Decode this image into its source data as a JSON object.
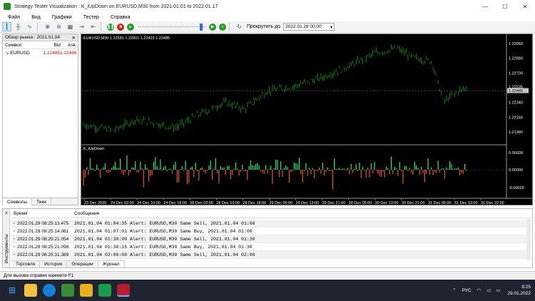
{
  "window": {
    "title": "Strategy Tester Visualization : K_iUpDown on EURUSD,M30 from 2021.01.01 to 2022.01.17",
    "controls": [
      "—",
      "☐",
      "✕"
    ]
  },
  "menu": [
    "Файл",
    "Вид",
    "Графики",
    "Тестер",
    "Справка"
  ],
  "toolbar": {
    "scroll_label": "Прокрутить до",
    "scroll_date": "2022.01.28 00:00",
    "slider_position": 0.95
  },
  "market_watch": {
    "title": "Обзор рынка : 2021.01.04",
    "close": "✕",
    "columns": [
      "Символ",
      "Bid",
      "Ask"
    ],
    "rows": [
      {
        "symbol": "EURUSD",
        "bid": "1.22485",
        "ask": "1.22486"
      }
    ],
    "tabs": [
      "Символы",
      "Тики"
    ]
  },
  "chart": {
    "header": "EURUSD,M30  1.22581 1.22601 1.22429 1.22485",
    "indicator_label": "K_iUpDown",
    "price_ticks": [
      "1.23060",
      "1.22880",
      "1.22700",
      "1.22535",
      "1.22485",
      "1.22340",
      "1.22160",
      "1.21980"
    ],
    "current_price": "1.22485",
    "indicator_ticks": [
      "0.00028",
      "0.00000",
      "-0.00029"
    ],
    "time_ticks": [
      "23 Dec 2020",
      "24 Dec 02:00",
      "24 Dec 10:00",
      "24 Dec 18:00",
      "28 Dec 02:00",
      "28 Dec 10:00",
      "28 Dec 18:00",
      "29 Dec 05:00",
      "29 Dec 13:00",
      "29 Dec 21:00",
      "30 Dec 05:00",
      "30 Dec 13:00",
      "30 Dec 21:00",
      "31 Dec 05:00",
      "31 Dec 13:00",
      "31 Dec 22:00"
    ],
    "colors": {
      "bg": "#000000",
      "candles": "#16a016",
      "up": "#2ee87a",
      "down": "#e8562b",
      "grid": "#555555"
    }
  },
  "toolbox": {
    "side_label": "Инструменты",
    "close": "✕",
    "columns": [
      "Время",
      "Сообщение"
    ],
    "rows": [
      {
        "time": "2022.01.29 08:25:13.475",
        "msg": "2021.01.04 01:04:35   Alert: EURUSD,M30 Same Sell, 2021.01.04 01:00"
      },
      {
        "time": "2022.01.29 08:25:14.061",
        "msg": "2021.01.04 01:07:01   Alert: EURUSD,M30 Same Buy, 2021.01.04 01:00"
      },
      {
        "time": "2022.01.29 08:25:21.054",
        "msg": "2021.01.04 01:30:00   Alert: EURUSD,M30 Same Sell, 2021.01.04 01:30"
      },
      {
        "time": "2022.01.29 08:25:21.098",
        "msg": "2021.01.04 01:30:15   Alert: EURUSD,M30 Same Buy, 2021.01.04 01:30"
      },
      {
        "time": "2022.01.29 08:25:31.389",
        "msg": "2021.01.04 02:00:00   Alert: EURUSD,M30 Same Sell, 2021.01.04 02:00"
      }
    ],
    "tabs": [
      "Торговля",
      "История",
      "Операции",
      "Журнал"
    ],
    "selected_tab": 3
  },
  "status": "Для вызова справки нажмите F1",
  "taskbar": {
    "lang": "РУС",
    "time": "8:25",
    "date": "29.01.2022"
  }
}
